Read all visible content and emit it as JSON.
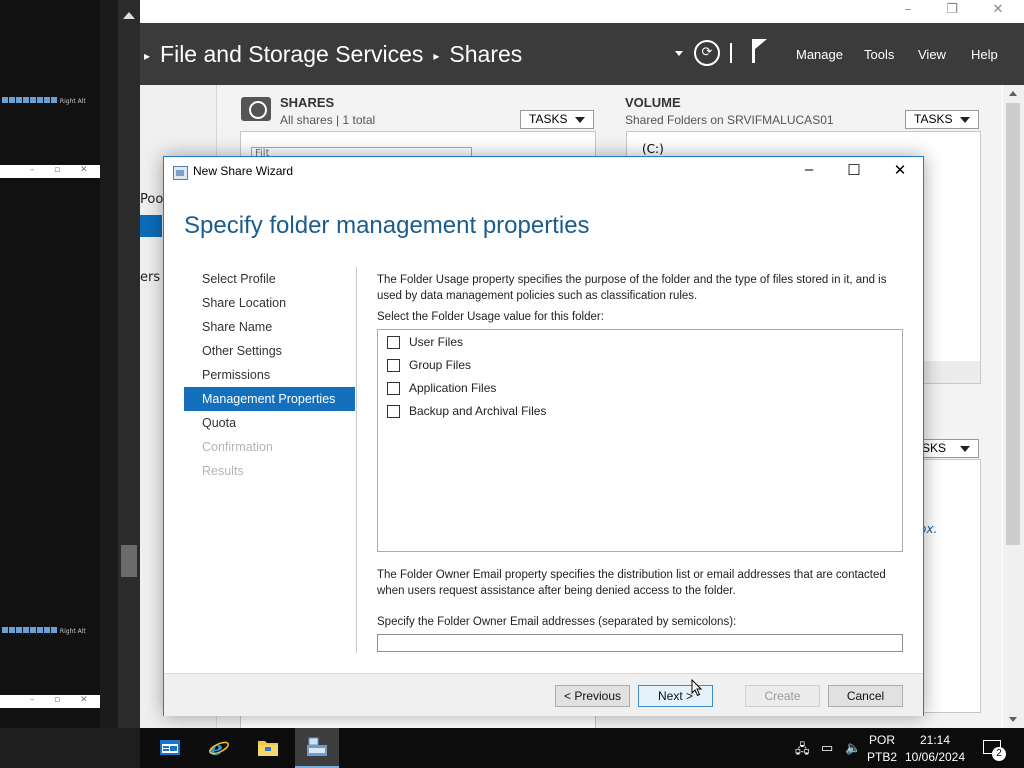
{
  "server_manager": {
    "breadcrumb": {
      "section": "File and Storage Services",
      "page": "Shares"
    },
    "menu": {
      "manage": "Manage",
      "tools": "Tools",
      "view": "View",
      "help": "Help"
    },
    "nav_partial": {
      "pools": "Poo",
      "servers": "ers"
    },
    "shares_tile": {
      "title": "SHARES",
      "subtitle": "All shares | 1 total",
      "tasks": "TASKS",
      "filter_placeholder": "Filt"
    },
    "volume_tile": {
      "title": "VOLUME",
      "subtitle": "Shared Folders on SRVIFMALUCAS01",
      "tasks": "TASKS",
      "drive": "(C:)"
    },
    "quota_tile": {
      "tasks": "ASKS",
      "link_fragment": "ox."
    }
  },
  "wizard": {
    "window_title": "New Share Wizard",
    "heading": "Specify folder management properties",
    "steps": [
      {
        "label": "Select Profile",
        "state": "normal"
      },
      {
        "label": "Share Location",
        "state": "normal"
      },
      {
        "label": "Share Name",
        "state": "normal"
      },
      {
        "label": "Other Settings",
        "state": "normal"
      },
      {
        "label": "Permissions",
        "state": "normal"
      },
      {
        "label": "Management Properties",
        "state": "active"
      },
      {
        "label": "Quota",
        "state": "normal"
      },
      {
        "label": "Confirmation",
        "state": "disabled"
      },
      {
        "label": "Results",
        "state": "disabled"
      }
    ],
    "usage_description": "The Folder Usage property specifies the purpose of the folder and the type of files stored in it, and is used by data management policies such as classification rules.",
    "usage_prompt": "Select the Folder Usage value for this folder:",
    "usage_options": [
      {
        "label": "User Files",
        "checked": false
      },
      {
        "label": "Group Files",
        "checked": false
      },
      {
        "label": "Application Files",
        "checked": false
      },
      {
        "label": "Backup and Archival Files",
        "checked": false
      }
    ],
    "email_description": "The Folder Owner Email property specifies the distribution list or email addresses that are contacted when users request assistance after being denied access to the folder.",
    "email_prompt": "Specify the Folder Owner Email addresses (separated by semicolons):",
    "email_value": "",
    "buttons": {
      "previous": "< Previous",
      "next": "Next >",
      "create": "Create",
      "cancel": "Cancel"
    }
  },
  "taskbar": {
    "language": "POR",
    "layout": "PTB2",
    "time": "21:14",
    "date": "10/06/2024",
    "notification_count": "2"
  },
  "host": {
    "tray_text": "Right Alt"
  }
}
